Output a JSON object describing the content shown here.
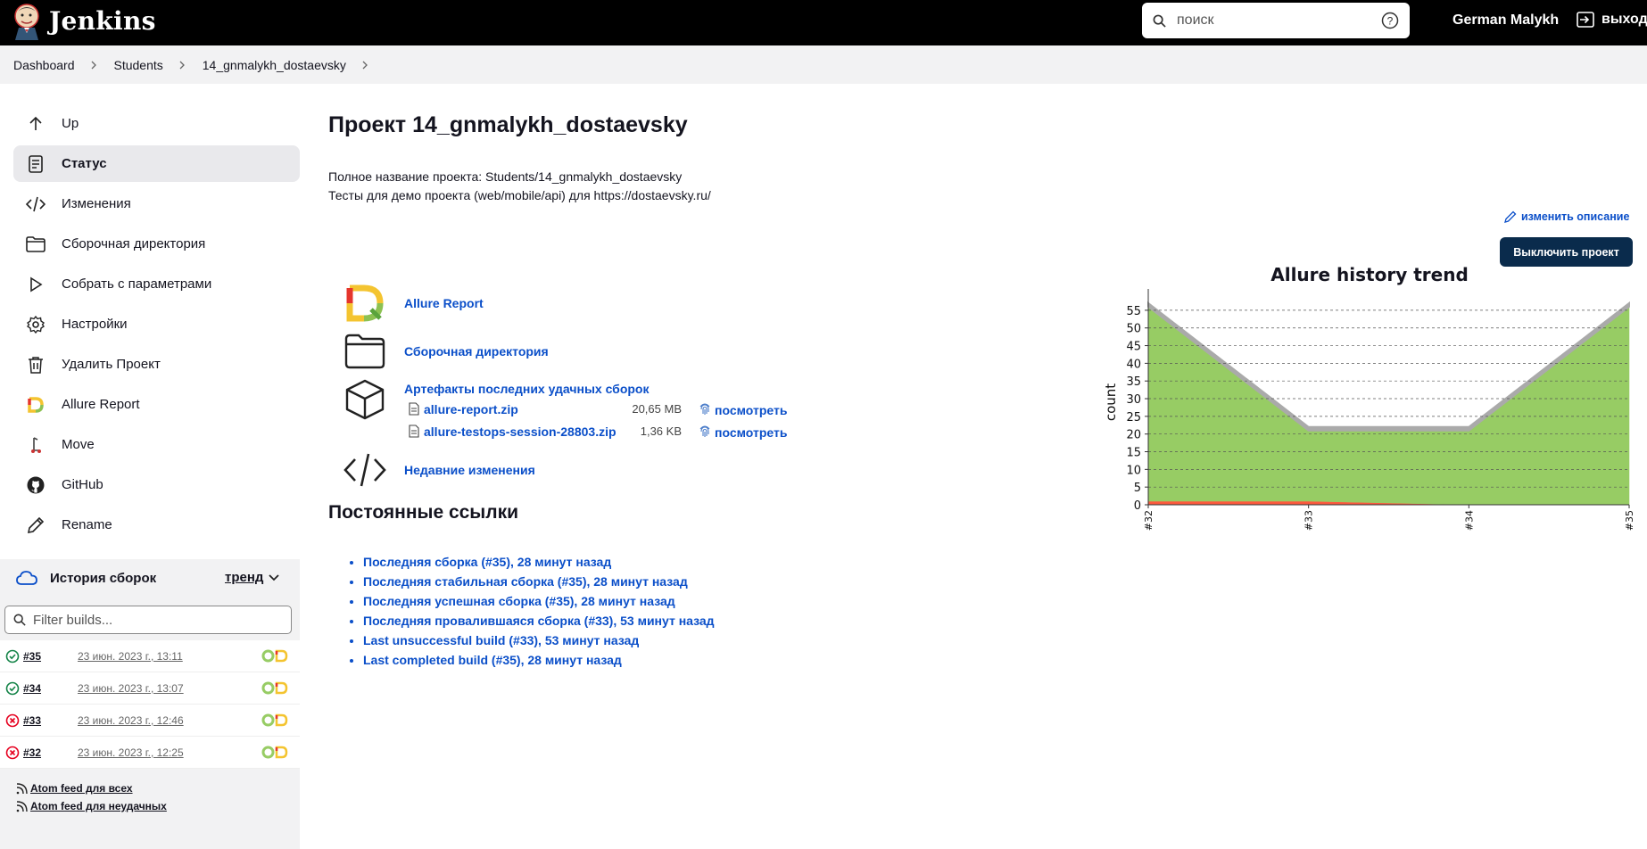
{
  "header": {
    "brand": "Jenkins",
    "search_placeholder": "поиск",
    "user_name": "German Malykh",
    "logout_label": "выход"
  },
  "breadcrumb": [
    "Dashboard",
    "Students",
    "14_gnmalykh_dostaevsky"
  ],
  "sidebar": {
    "items": [
      {
        "label": "Up",
        "icon": "arrow-up-icon"
      },
      {
        "label": "Статус",
        "icon": "document-icon"
      },
      {
        "label": "Изменения",
        "icon": "code-icon"
      },
      {
        "label": "Сборочная директория",
        "icon": "folder-icon"
      },
      {
        "label": "Собрать с параметрами",
        "icon": "play-icon"
      },
      {
        "label": "Настройки",
        "icon": "gear-icon"
      },
      {
        "label": "Удалить Проект",
        "icon": "trash-icon"
      },
      {
        "label": "Allure Report",
        "icon": "allure-icon"
      },
      {
        "label": "Move",
        "icon": "move-icon"
      },
      {
        "label": "GitHub",
        "icon": "github-icon"
      },
      {
        "label": "Rename",
        "icon": "pencil-icon"
      }
    ]
  },
  "history": {
    "title": "История сборок",
    "trend_label": "тренд",
    "filter_placeholder": "Filter builds...",
    "builds": [
      {
        "num": "#35",
        "date": "23 июн. 2023 г., 13:11",
        "status": "success"
      },
      {
        "num": "#34",
        "date": "23 июн. 2023 г., 13:07",
        "status": "success"
      },
      {
        "num": "#33",
        "date": "23 июн. 2023 г., 12:46",
        "status": "failed"
      },
      {
        "num": "#32",
        "date": "23 июн. 2023 г., 12:25",
        "status": "failed"
      }
    ],
    "feeds": [
      "Atom feed для всех",
      "Atom feed для неудачных"
    ]
  },
  "main": {
    "title": "Проект 14_gnmalykh_dostaevsky",
    "full_name": "Полное название проекта: Students/14_gnmalykh_dostaevsky",
    "description": "Тесты для демо проекта (web/mobile/api) для https://dostaevsky.ru/",
    "edit_description": "изменить описание",
    "disable_button": "Выключить проект",
    "links": {
      "allure": "Allure Report",
      "workspace": "Сборочная директория",
      "artifacts_title": "Артефакты последних удачных сборок",
      "recent_changes": "Недавние изменения"
    },
    "artifacts": [
      {
        "name": "allure-report.zip",
        "size": "20,65 MB",
        "view": "посмотреть"
      },
      {
        "name": "allure-testops-session-28803.zip",
        "size": "1,36 KB",
        "view": "посмотреть"
      }
    ],
    "permalinks_title": "Постоянные ссылки",
    "permalinks": [
      "Последняя сборка (#35), 28 минут назад",
      "Последняя стабильная сборка (#35), 28 минут назад",
      "Последняя успешная сборка (#35), 28 минут назад",
      "Последняя провалившаяся сборка (#33), 53 минут назад",
      "Last unsuccessful build (#33), 53 минут назад",
      "Last completed build (#35), 28 минут назад"
    ]
  },
  "colors": {
    "passed": "#97cc64",
    "failed": "#fd5a3e",
    "broken": "#ffd050",
    "skipped": "#aaaaaa",
    "link": "#0b4fc9",
    "button": "#0a2b4c"
  },
  "chart_data": {
    "type": "area",
    "title": "Allure history trend",
    "ylabel": "count",
    "xlabel": "",
    "categories": [
      "#32",
      "#33",
      "#34",
      "#35"
    ],
    "ylim": [
      0,
      58
    ],
    "yticks": [
      0,
      5,
      10,
      15,
      20,
      25,
      30,
      35,
      40,
      45,
      50,
      55
    ],
    "grid": true,
    "series": [
      {
        "key": "failed",
        "values": [
          1,
          1,
          0,
          0
        ],
        "color": "#fd5a3e"
      },
      {
        "key": "passed",
        "values": [
          55,
          20,
          21,
          56
        ],
        "color": "#97cc64"
      },
      {
        "key": "skipped",
        "values": [
          1,
          1,
          1,
          1
        ],
        "color": "#aaaaaa"
      }
    ]
  }
}
